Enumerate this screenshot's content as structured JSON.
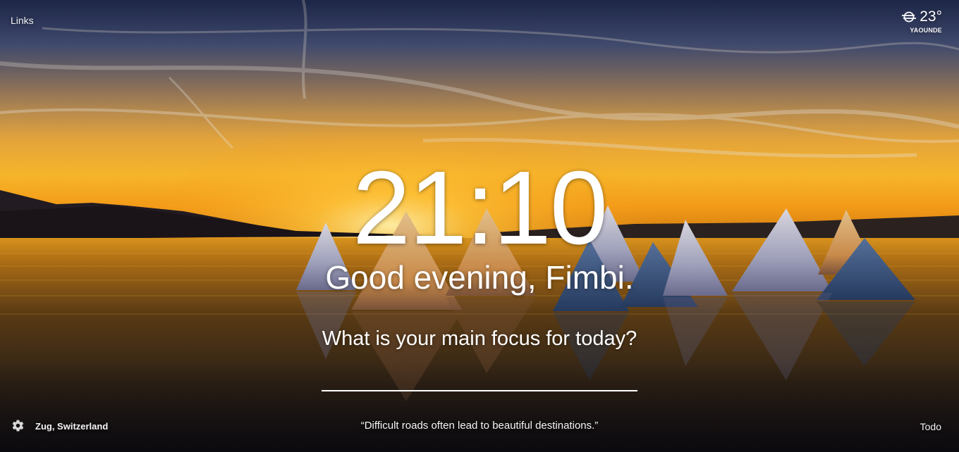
{
  "top_left": {
    "links_label": "Links"
  },
  "weather": {
    "icon": "windy-icon",
    "temperature": "23°",
    "city": "YAOUNDE"
  },
  "clock": {
    "time": "21:10"
  },
  "greeting": {
    "text": "Good evening, Fimbi."
  },
  "focus": {
    "question": "What is your main focus for today?",
    "input_value": ""
  },
  "footer": {
    "settings_icon": "gear-icon",
    "location": "Zug, Switzerland",
    "quote": "“Difficult roads often lead to beautiful destinations.”",
    "todo_label": "Todo"
  },
  "colors": {
    "sky_top": "#2f3f73",
    "sunset_glow": "#f0a21c",
    "water": "#3a2a14",
    "text": "#ffffff"
  }
}
